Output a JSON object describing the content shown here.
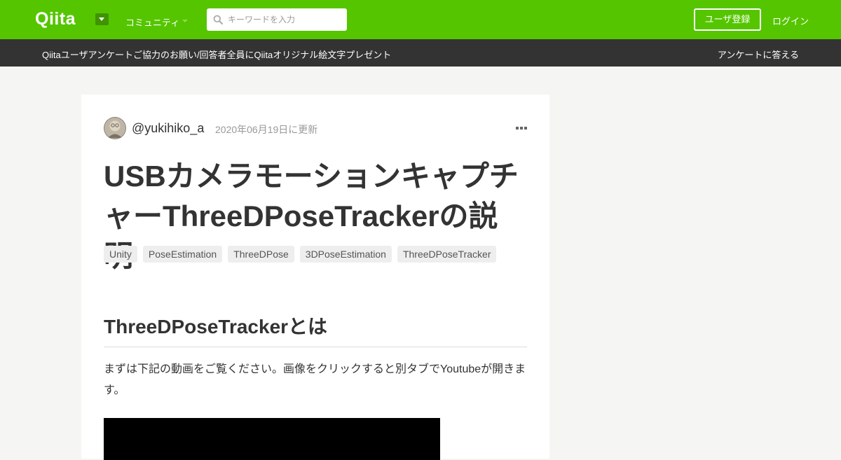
{
  "header": {
    "logo": "Qiita",
    "community_label": "コミュニティ",
    "search_placeholder": "キーワードを入力",
    "signup_label": "ユーザ登録",
    "login_label": "ログイン",
    "brand_color": "#55c500"
  },
  "banner": {
    "text": "Qiitaユーザアンケートご協力のお願い/回答者全員にQiitaオリジナル絵文字プレゼント",
    "link": "アンケートに答える"
  },
  "article": {
    "author": "@yukihiko_a",
    "updated": "2020年06月19日に更新",
    "title": "USBカメラモーションキャプチャーThreeDPoseTrackerの説明",
    "tags": [
      "Unity",
      "PoseEstimation",
      "ThreeDPose",
      "3DPoseEstimation",
      "ThreeDPoseTracker"
    ],
    "section_heading": "ThreeDPoseTrackerとは",
    "paragraph": "まずは下記の動画をご覧ください。画像をクリックすると別タブでYoutubeが開きます。"
  },
  "icons": {
    "search": "search-icon",
    "more": "more-icon",
    "logo_dropdown": "chevron-down-icon"
  }
}
